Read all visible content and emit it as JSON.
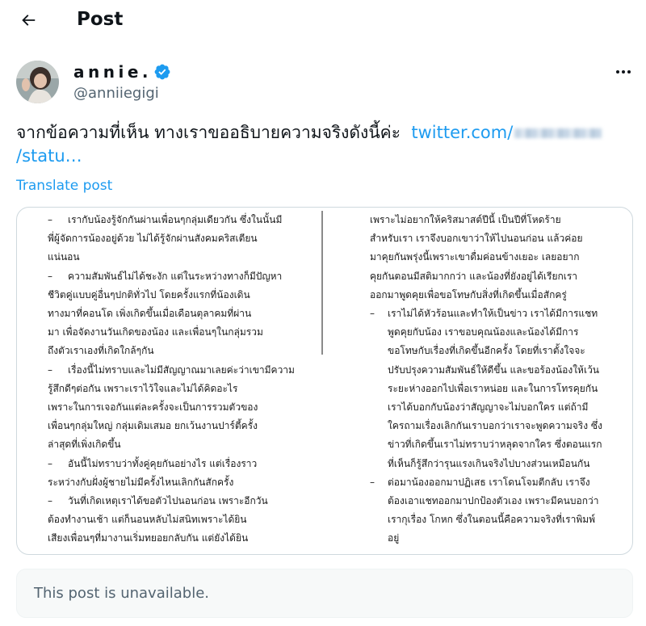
{
  "header": {
    "title": "Post",
    "back_icon": "arrow-left-icon"
  },
  "author": {
    "display_name": "annie.",
    "handle": "@anniiegigi",
    "verified_color": "#1d9bf0"
  },
  "post": {
    "text": "จากข้อความที่เห็น ทางเราขออธิบายความจริงดังนี้ค่ะ",
    "link_prefix": "twitter.com/",
    "link_suffix": "/statu…",
    "translate_label": "Translate post"
  },
  "image_text": {
    "left": [
      {
        "type": "b",
        "t": "เรากับน้องรู้จักกันผ่านเพื่อนๆกลุ่มเดียวกัน ซึ่งในนั้นมี"
      },
      {
        "type": "c",
        "t": "พี่ผู้จัดการน้องอยู่ด้วย ไม่ได้รู้จักผ่านสังคมคริสเตียน"
      },
      {
        "type": "c",
        "t": "แน่นอน"
      },
      {
        "type": "b",
        "t": "ความสัมพันธ์ไม่ได้ชะงัก แต่ในระหว่างทางก็มีปัญหา"
      },
      {
        "type": "c",
        "t": "ชีวิตคู่แบบคู่อื่นๆปกติทั่วไป โดยครั้งแรกที่น้องเดิน"
      },
      {
        "type": "c",
        "t": "ทางมาที่คอนโด เพิ่งเกิดขึ้นเมื่อเดือนตุลาคมที่ผ่าน"
      },
      {
        "type": "c",
        "t": "มา เพื่อจัดงานวันเกิดของน้อง และเพื่อนๆในกลุ่มรวม"
      },
      {
        "type": "c",
        "t": "ถึงตัวเราเองที่เกิดใกล้ๆกัน"
      },
      {
        "type": "b",
        "t": "เรื่องนี้ไม่ทราบและไม่มีสัญญาณมาเลยค่ะว่าเขามีความ"
      },
      {
        "type": "c",
        "t": "รู้สึกดีๆต่อกัน เพราะเราไว้ใจและไม่ได้คิดอะไร"
      },
      {
        "type": "c",
        "t": "เพราะในการเจอกันแต่ละครั้งจะเป็นการรวมตัวของ"
      },
      {
        "type": "c",
        "t": "เพื่อนๆกลุ่มใหญ่ กลุ่มเดิมเสมอ ยกเว้นงานปาร์ตี้ครั้ง"
      },
      {
        "type": "c",
        "t": "ล่าสุดที่เพิ่งเกิดขึ้น"
      },
      {
        "type": "b",
        "t": "อันนี้ไม่ทราบว่าทั้งคู่คุยกันอย่างไร แต่เรื่องราว"
      },
      {
        "type": "c",
        "t": "ระหว่างกับฝั่งผู้ชายไม่มีครั้งไหนเลิกกันสักครั้ง"
      },
      {
        "type": "b",
        "t": "วันที่เกิดเหตุเราได้ขอตัวไปนอนก่อน เพราะอีกวัน"
      },
      {
        "type": "c",
        "t": "ต้องทำงานเช้า แต่ก็นอนหลับไม่สนิทเพราะได้ยิน"
      },
      {
        "type": "c",
        "t": "เสียงเพื่อนๆที่มางานเริ่มทยอยกลับกัน แต่ยังได้ยิน"
      }
    ],
    "right": [
      {
        "type": "f",
        "t": "เพราะไม่อยากให้คริสมาสต์ปีนี้ เป็นปีที่โหดร้าย"
      },
      {
        "type": "f",
        "t": "สำหรับเรา เราจึงบอกเขาว่าให้ไปนอนก่อน แล้วค่อย"
      },
      {
        "type": "f",
        "t": "มาคุยกันพรุ่งนี้เพราะเขาดื่มค่อนข้างเยอะ เลยอยาก"
      },
      {
        "type": "f",
        "t": "คุยกันตอนมีสติมากกว่า และน้องที่ยังอยู่ได้เรียกเรา"
      },
      {
        "type": "f",
        "t": "ออกมาพูดคุยเพื่อขอโทษกับสิ่งที่เกิดขึ้นเมื่อสักครู่"
      },
      {
        "type": "b",
        "t": "เราไม่ได้หัวร้อนและทำให้เป็นข่าว เราได้มีการแชท"
      },
      {
        "type": "c",
        "t": "พูดคุยกับน้อง เราขอบคุณน้องและน้องได้มีการ"
      },
      {
        "type": "c",
        "t": "ขอโทษกับเรื่องที่เกิดขึ้นอีกครั้ง โดยที่เราตั้งใจจะ"
      },
      {
        "type": "c",
        "t": "ปรับปรุงความสัมพันธ์ให้ดีขึ้น และขอร้องน้องให้เว้น"
      },
      {
        "type": "c",
        "t": "ระยะห่างออกไปเพื่อเราหน่อย และในการโทรคุยกัน"
      },
      {
        "type": "c",
        "t": "เราได้บอกกับน้องว่าสัญญาจะไม่บอกใคร แต่ถ้ามี"
      },
      {
        "type": "c",
        "t": "ใครถามเรื่องเลิกกันเราบอกว่าเราจะพูดความจริง ซึ่ง"
      },
      {
        "type": "c",
        "t": "ข่าวที่เกิดขึ้นเราไม่ทราบว่าหลุดจากใคร ซึ่งตอนแรก"
      },
      {
        "type": "c",
        "t": "ที่เห็นก็รู้สึกว่ารุนแรงเกินจริงไปบางส่วนเหมือนกัน"
      },
      {
        "type": "b",
        "t": "ต่อมาน้องออกมาปฏิเสธ เราโดนโจมตีกลับ เราจึง"
      },
      {
        "type": "c",
        "t": "ต้องเอาแชทออกมาปกป้องตัวเอง เพราะมีคนบอกว่า"
      },
      {
        "type": "c",
        "t": "เรากุเรื่อง โกหก ซึ่งในตอนนี้คือความจริงที่เราพิมพ์"
      },
      {
        "type": "c",
        "t": "อยู่"
      }
    ]
  },
  "quoted": {
    "unavailable_text": "This post is unavailable."
  }
}
